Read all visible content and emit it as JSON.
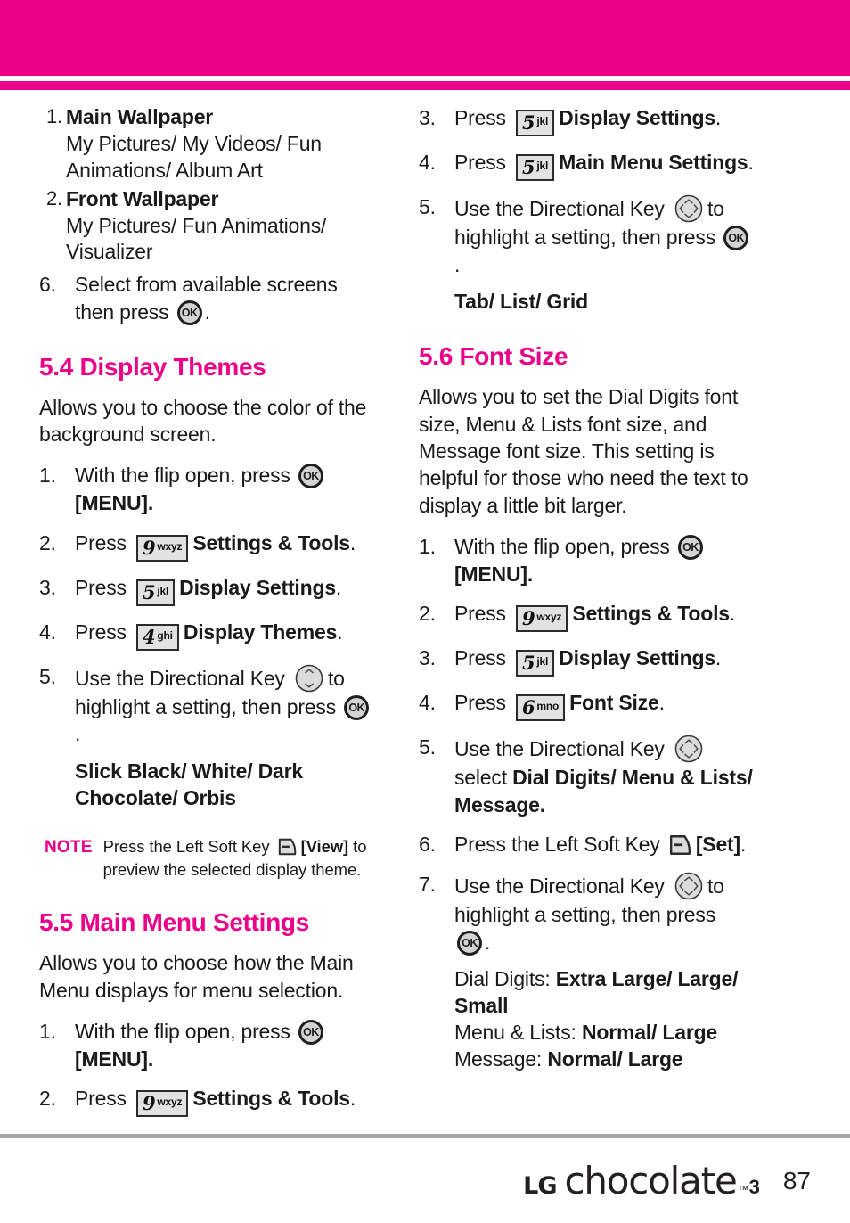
{
  "header": {
    "band_color": "#ec0089",
    "stripe_color": "#ec0089"
  },
  "left_column": {
    "continued_substeps": [
      {
        "num": "1.",
        "title": "Main Wallpaper",
        "detail": "My Pictures/ My Videos/ Fun Animations/ Album Art"
      },
      {
        "num": "2.",
        "title": "Front Wallpaper",
        "detail": "My Pictures/ Fun Animations/ Visualizer"
      }
    ],
    "continued_step6": {
      "num": "6.",
      "text_before": "Select from available screens then press",
      "key": "ok-key",
      "text_after": "."
    },
    "section_54": {
      "title": "5.4 Display Themes",
      "intro": "Allows you to choose the color of the background screen.",
      "steps": [
        {
          "num": "1.",
          "before": "With the flip open, press",
          "key": "ok-key",
          "after": "[MENU]."
        },
        {
          "num": "2.",
          "before": "Press",
          "key": "9wxyz",
          "digit": "9",
          "letters": "wxyz",
          "after": "Settings & Tools",
          "period": "."
        },
        {
          "num": "3.",
          "before": "Press",
          "key": "5jkl",
          "digit": "5",
          "letters": "jkl",
          "after": "Display Settings",
          "period": "."
        },
        {
          "num": "4.",
          "before": "Press",
          "key": "4ghi",
          "digit": "4",
          "letters": "ghi",
          "after": "Display Themes",
          "period": "."
        },
        {
          "num": "5.",
          "before": "Use the Directional Key",
          "key": "nav-key-updown",
          "mid": "to highlight a setting, then press",
          "key2": "ok-key",
          "after": "."
        }
      ],
      "options": "Slick Black/ White/ Dark Chocolate/ Orbis",
      "note": {
        "label": "NOTE",
        "before": "Press the Left Soft Key",
        "key": "soft-key",
        "bold": "[View]",
        "after": "to preview the selected display theme."
      }
    },
    "section_55": {
      "title": "5.5 Main Menu Settings",
      "intro": "Allows you to choose how the Main Menu displays for menu selection.",
      "steps": [
        {
          "num": "1.",
          "before": "With the flip open, press",
          "key": "ok-key",
          "after": "[MENU]."
        },
        {
          "num": "2.",
          "before": "Press",
          "key": "9wxyz",
          "digit": "9",
          "letters": "wxyz",
          "after": "Settings & Tools",
          "period": "."
        }
      ]
    }
  },
  "right_column": {
    "section_55_continued": {
      "steps": [
        {
          "num": "3.",
          "before": "Press",
          "key": "5jkl",
          "digit": "5",
          "letters": "jkl",
          "after": "Display Settings",
          "period": "."
        },
        {
          "num": "4.",
          "before": "Press",
          "key": "5jkl",
          "digit": "5",
          "letters": "jkl",
          "after": "Main Menu Settings",
          "period": "."
        },
        {
          "num": "5.",
          "before": "Use the Directional Key",
          "key": "nav-key-4way",
          "mid": "to highlight a setting, then press",
          "key2": "ok-key",
          "after": "."
        }
      ],
      "options": "Tab/ List/ Grid"
    },
    "section_56": {
      "title": "5.6 Font Size",
      "intro": "Allows you to set the Dial Digits font size, Menu & Lists font size, and Message font size. This setting is helpful for those who need the text to display a little bit larger.",
      "steps": [
        {
          "num": "1.",
          "before": "With the flip open, press",
          "key": "ok-key",
          "after": "[MENU]."
        },
        {
          "num": "2.",
          "before": "Press",
          "key": "9wxyz",
          "digit": "9",
          "letters": "wxyz",
          "after": "Settings & Tools",
          "period": "."
        },
        {
          "num": "3.",
          "before": "Press",
          "key": "5jkl",
          "digit": "5",
          "letters": "jkl",
          "after": "Display Settings",
          "period": "."
        },
        {
          "num": "4.",
          "before": "Press",
          "key": "6mno",
          "digit": "6",
          "letters": "mno",
          "after": "Font Size",
          "period": "."
        },
        {
          "num": "5.",
          "before": "Use the Directional Key",
          "key": "nav-key-4way",
          "mid": "select",
          "bold": "Dial Digits/ Menu & Lists/ Message.",
          "after": ""
        },
        {
          "num": "6.",
          "before": "Press the Left Soft Key",
          "key": "soft-key",
          "bold": "[Set]",
          "after": "."
        },
        {
          "num": "7.",
          "before": "Use the Directional Key",
          "key": "nav-key-4way",
          "mid": "to highlight a setting, then press",
          "key2": "ok-key",
          "after": "."
        }
      ],
      "results": [
        {
          "label": "Dial Digits:",
          "value": "Extra Large/ Large/ Small"
        },
        {
          "label": "Menu & Lists:",
          "value": "Normal/ Large"
        },
        {
          "label": "Message:",
          "value": "Normal/ Large"
        }
      ]
    }
  },
  "footer": {
    "brand_lg": "LG",
    "brand_name": "chocolate",
    "brand_tm": "™",
    "brand_version": "3",
    "page_number": "87"
  }
}
